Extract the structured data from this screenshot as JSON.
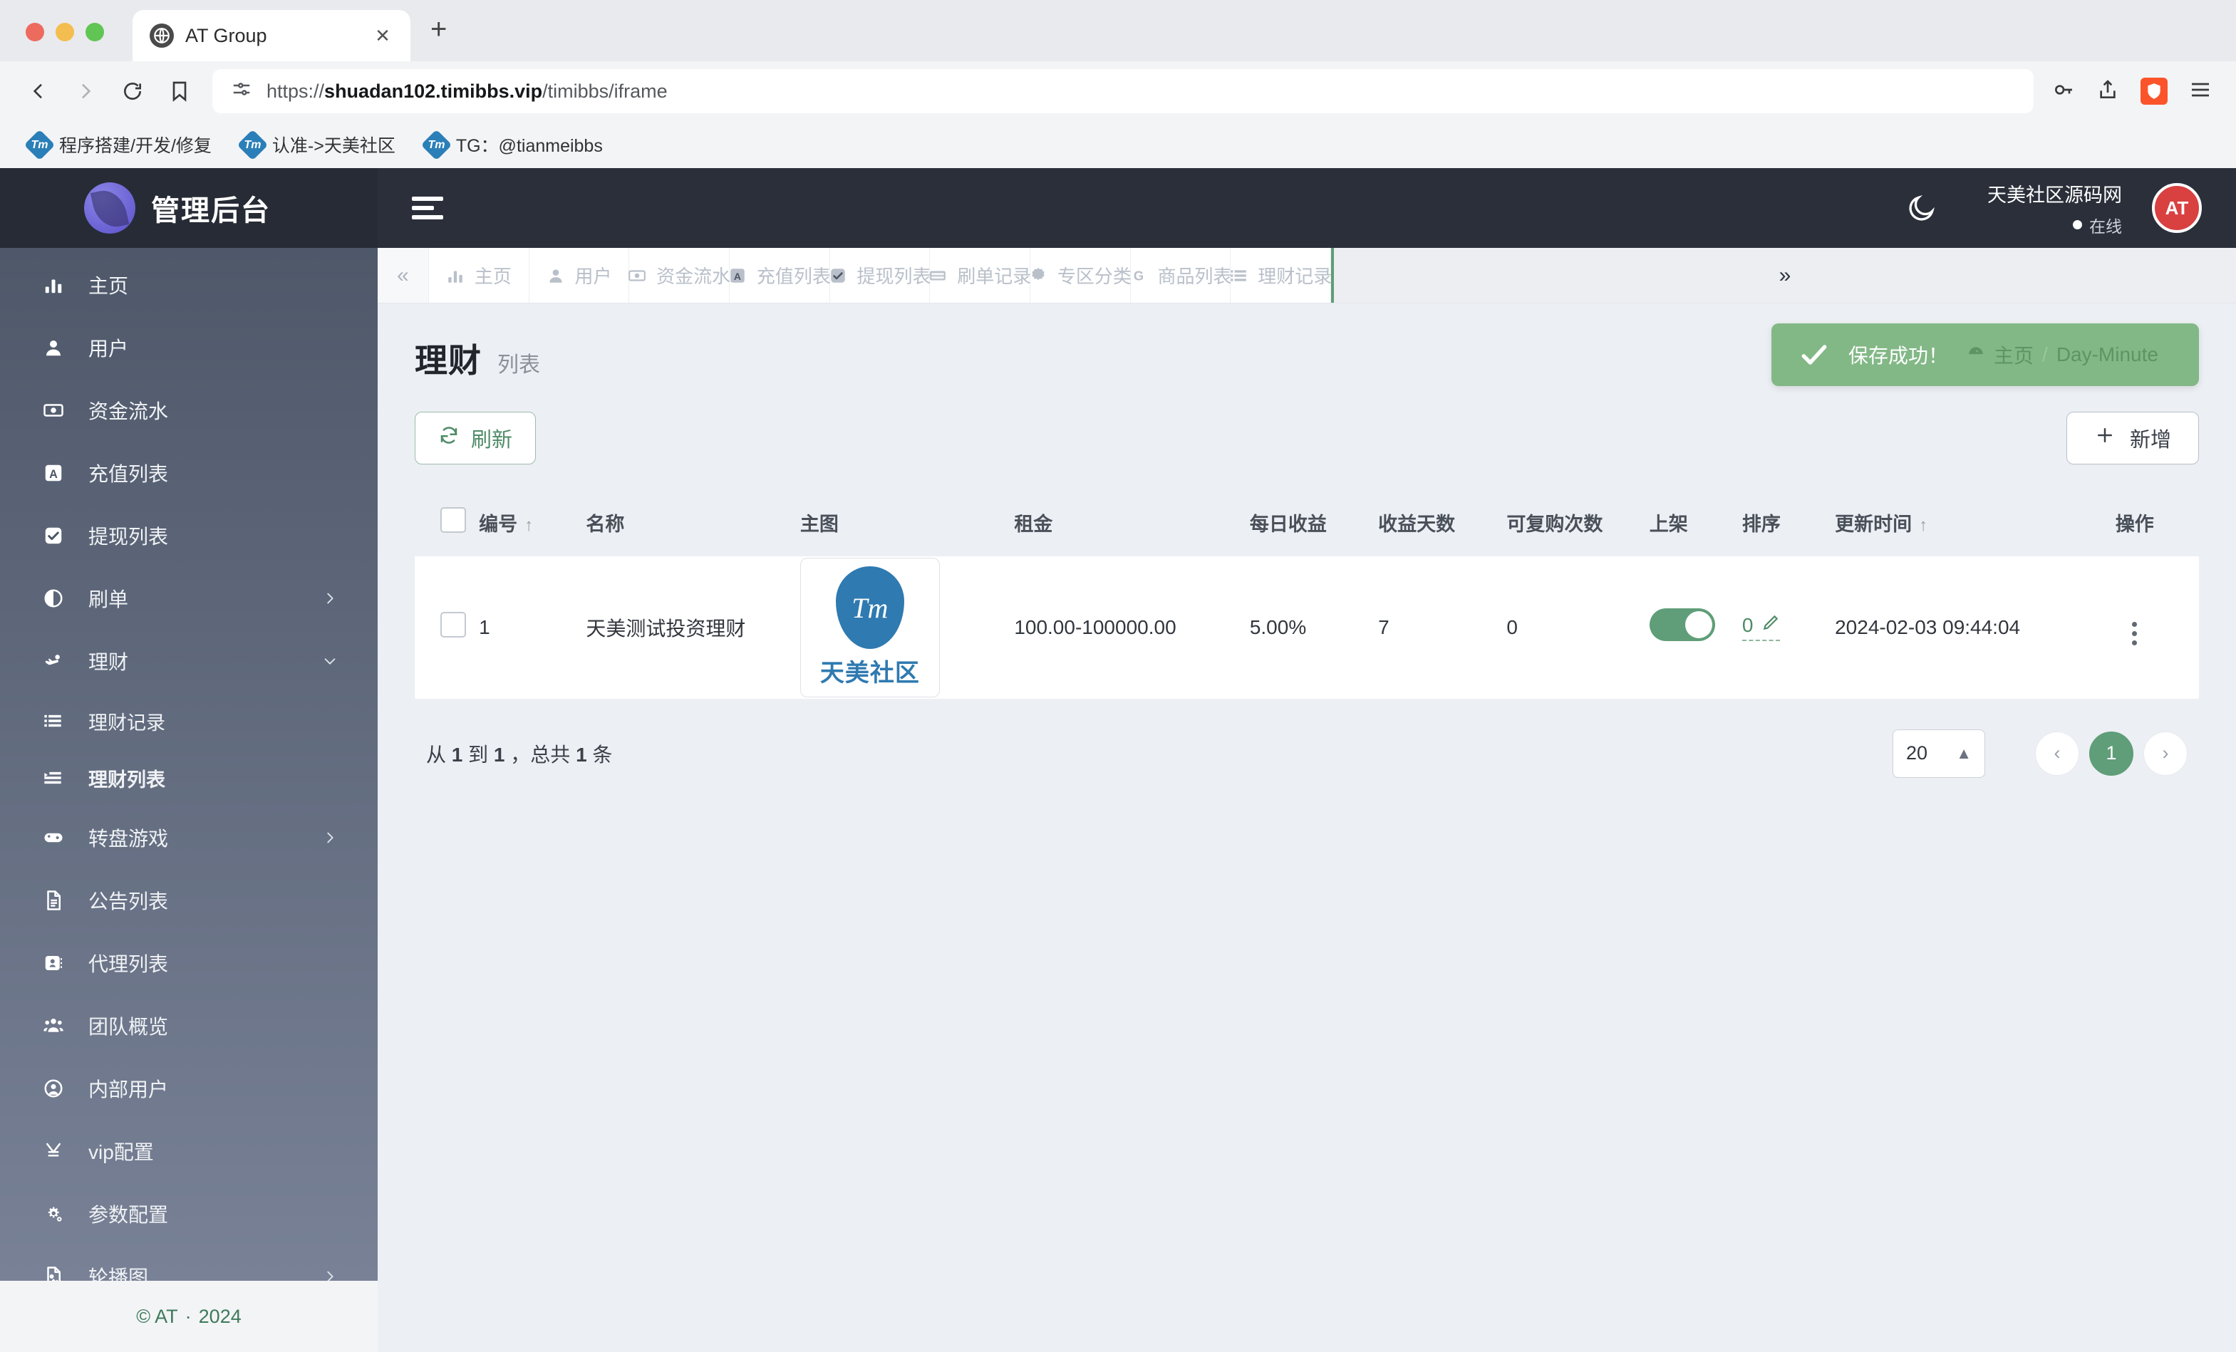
{
  "browser": {
    "tab": {
      "title": "AT Group",
      "favicon": "globe-icon",
      "close": "✕"
    },
    "new_tab": "+",
    "url_prefix": "https://",
    "url_bold": "shuadan102.timibbs.vip",
    "url_suffix": "/timibbs/iframe",
    "bookmarks": [
      {
        "label": "程序搭建/开发/修复",
        "icon": "Tm"
      },
      {
        "label": "认准->天美社区",
        "icon": "Tm"
      },
      {
        "label": "TG：@tianmeibbs",
        "icon": "Tm"
      }
    ]
  },
  "sidebar": {
    "brand": "管理后台",
    "items": [
      {
        "label": "主页",
        "icon": "chart-bar-icon",
        "chevron": false,
        "sub": false,
        "active": false
      },
      {
        "label": "用户",
        "icon": "user-icon",
        "chevron": false,
        "sub": false,
        "active": false
      },
      {
        "label": "资金流水",
        "icon": "money-bill-icon",
        "chevron": false,
        "sub": false,
        "active": false
      },
      {
        "label": "充值列表",
        "icon": "letter-a-icon",
        "chevron": false,
        "sub": false,
        "active": false
      },
      {
        "label": "提现列表",
        "icon": "check-square-icon",
        "chevron": false,
        "sub": false,
        "active": false
      },
      {
        "label": "刷单",
        "icon": "half-circle-icon",
        "chevron": true,
        "sub": false,
        "active": false
      },
      {
        "label": "理财",
        "icon": "hand-coin-icon",
        "chevron": true,
        "expanded": true,
        "sub": false,
        "active": false
      },
      {
        "label": "理财记录",
        "icon": "list-icon",
        "chevron": false,
        "sub": true,
        "active": false
      },
      {
        "label": "理财列表",
        "icon": "list-indent-icon",
        "chevron": false,
        "sub": true,
        "active": true
      },
      {
        "label": "转盘游戏",
        "icon": "gamepad-icon",
        "chevron": true,
        "sub": false,
        "active": false
      },
      {
        "label": "公告列表",
        "icon": "file-text-icon",
        "chevron": false,
        "sub": false,
        "active": false
      },
      {
        "label": "代理列表",
        "icon": "id-card-icon",
        "chevron": false,
        "sub": false,
        "active": false
      },
      {
        "label": "团队概览",
        "icon": "users-icon",
        "chevron": false,
        "sub": false,
        "active": false
      },
      {
        "label": "内部用户",
        "icon": "user-circle-icon",
        "chevron": false,
        "sub": false,
        "active": false
      },
      {
        "label": "vip配置",
        "icon": "yen-icon",
        "chevron": false,
        "sub": false,
        "active": false
      },
      {
        "label": "参数配置",
        "icon": "gears-icon",
        "chevron": false,
        "sub": false,
        "active": false
      },
      {
        "label": "轮播图",
        "icon": "image-icon",
        "chevron": true,
        "sub": false,
        "active": false
      }
    ],
    "footer": {
      "copyright": "© AT",
      "separator": "·",
      "year": "2024"
    }
  },
  "topbar": {
    "menu_icon": "hamburger-icon",
    "theme_icon": "moon-icon",
    "user_name": "天美社区源码网",
    "user_status": "在线",
    "avatar_text": "AT"
  },
  "pagetabs": {
    "left_arrow": "«",
    "right_arrow": "»",
    "items": [
      {
        "label": "主页",
        "icon": "chart-bar-icon"
      },
      {
        "label": "用户",
        "icon": "user-icon"
      },
      {
        "label": "资金流水",
        "icon": "money-bill-icon"
      },
      {
        "label": "充值列表",
        "icon": "letter-a-icon"
      },
      {
        "label": "提现列表",
        "icon": "check-square-icon"
      },
      {
        "label": "刷单记录",
        "icon": "credit-card-amex-icon"
      },
      {
        "label": "专区分类",
        "icon": "badge-icon"
      },
      {
        "label": "商品列表",
        "icon": "letter-g-icon"
      },
      {
        "label": "理财记录",
        "icon": "list-icon"
      }
    ]
  },
  "page": {
    "title": "理财",
    "subtitle": "列表",
    "toast": {
      "icon": "check-icon",
      "message": "保存成功！",
      "crumb_icon": "dashboard-icon",
      "crumb_home": "主页",
      "crumb_sep": "/",
      "crumb_current": "Day-Minute"
    },
    "toolbar": {
      "refresh_label": "刷新",
      "refresh_icon": "refresh-icon",
      "add_label": "新增",
      "add_icon": "plus-icon"
    },
    "table": {
      "columns": [
        {
          "key": "checkbox",
          "label": "",
          "sort": ""
        },
        {
          "key": "id",
          "label": "编号",
          "sort": "↑"
        },
        {
          "key": "name",
          "label": "名称",
          "sort": ""
        },
        {
          "key": "image",
          "label": "主图",
          "sort": ""
        },
        {
          "key": "rent",
          "label": "租金",
          "sort": ""
        },
        {
          "key": "daily",
          "label": "每日收益",
          "sort": ""
        },
        {
          "key": "days",
          "label": "收益天数",
          "sort": ""
        },
        {
          "key": "repeat",
          "label": "可复购次数",
          "sort": ""
        },
        {
          "key": "online",
          "label": "上架",
          "sort": ""
        },
        {
          "key": "order",
          "label": "排序",
          "sort": ""
        },
        {
          "key": "updated",
          "label": "更新时间",
          "sort": "↑"
        },
        {
          "key": "ops",
          "label": "操作",
          "sort": ""
        }
      ],
      "rows": [
        {
          "id": "1",
          "name": "天美测试投资理财",
          "image_mark": "Tm",
          "image_text": "天美社区",
          "rent": "100.00-100000.00",
          "daily": "5.00%",
          "days": "7",
          "repeat": "0",
          "online": true,
          "order": "0",
          "updated": "2024-02-03 09:44:04",
          "ops_icon": "kebab-icon"
        }
      ]
    },
    "footer": {
      "summary_prefix": "从 ",
      "summary_from": "1",
      "summary_mid": " 到 ",
      "summary_to": "1",
      "summary_mid2": " ，总共 ",
      "summary_total": "1",
      "summary_suffix": " 条",
      "page_size": "20",
      "prev": "‹",
      "next": "›",
      "current_page": "1"
    }
  },
  "colors": {
    "accent_green": "#5f9e78",
    "toast_green": "#82b886",
    "sidebar_top": "#4b5566",
    "sidebar_bottom": "#7b8499",
    "topbar_dark": "#2a2f3a",
    "brand_dark": "#262b35",
    "avatar_red": "#d94040",
    "logo_blue": "#2f7ab0"
  }
}
